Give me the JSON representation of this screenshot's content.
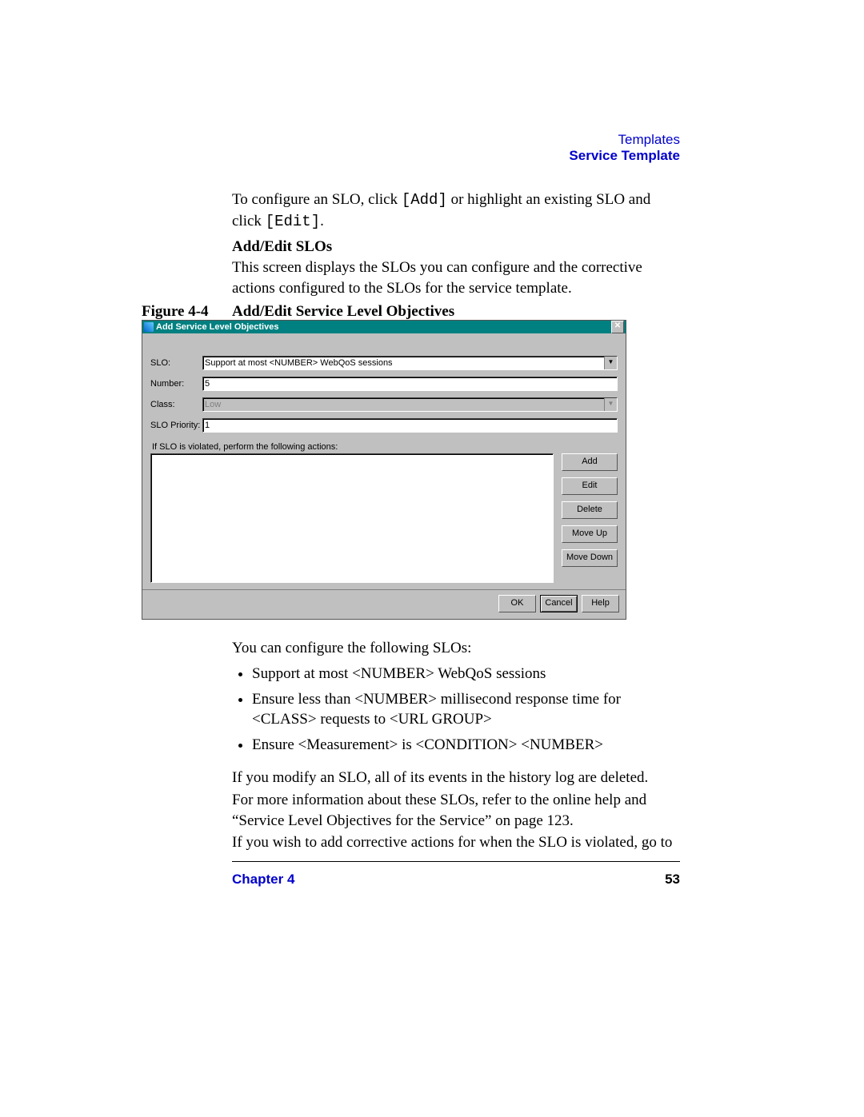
{
  "header": {
    "line1": "Templates",
    "line2": "Service Template"
  },
  "intro": {
    "prefix": "To configure an SLO, click ",
    "code1": "[Add]",
    "mid": " or highlight an existing SLO and click ",
    "code2": "[Edit]",
    "suffix": "."
  },
  "section_title": "Add/Edit SLOs",
  "section_body": "This screen displays the SLOs you can configure and the corrective actions configured to the SLOs for the service template.",
  "figure": {
    "label": "Figure 4-4",
    "caption": "Add/Edit Service Level Objectives"
  },
  "dialog": {
    "title": "Add Service Level Objectives",
    "fields": {
      "slo_label": "SLO:",
      "slo_value": "Support at most <NUMBER> WebQoS sessions",
      "number_label": "Number:",
      "number_value": "5",
      "class_label": "Class:",
      "class_value": "Low",
      "priority_label": "SLO Priority:",
      "priority_value": "1"
    },
    "actions_caption": "If SLO is violated, perform the following actions:",
    "buttons": {
      "add": "Add",
      "edit": "Edit",
      "delete": "Delete",
      "moveup": "Move Up",
      "movedown": "Move Down",
      "ok": "OK",
      "cancel": "Cancel",
      "help": "Help"
    }
  },
  "post_figure_lead": "You can configure the following SLOs:",
  "slo_list": [
    "Support at most <NUMBER> WebQoS sessions",
    "Ensure less than <NUMBER> millisecond response time for <CLASS> requests to <URL GROUP>",
    "Ensure <Measurement> is <CONDITION> <NUMBER>"
  ],
  "para_modify": "If you modify an SLO, all of its events in the history log are deleted.",
  "para_moreinfo": "For more information about these SLOs, refer to the online help and “Service Level Objectives for the Service” on page 123.",
  "para_corrective": "If you wish to add corrective actions for when the SLO is violated, go to",
  "footer": {
    "chapter": "Chapter 4",
    "page": "53"
  }
}
